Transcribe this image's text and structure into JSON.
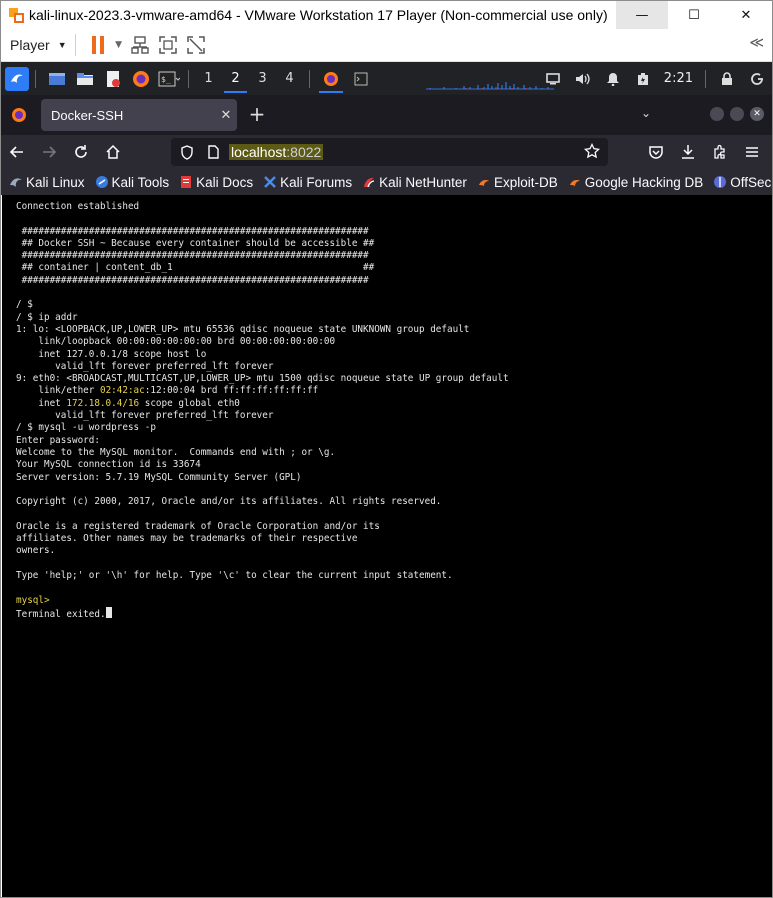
{
  "window": {
    "title": "kali-linux-2023.3-vmware-amd64 - VMware Workstation 17 Player (Non-commercial use only)",
    "controls": {
      "minimize": "—",
      "maximize": "☐",
      "close": "✕"
    }
  },
  "vmware_toolbar": {
    "player_label": "Player"
  },
  "kali_panel": {
    "workspaces": [
      "1",
      "2",
      "3",
      "4"
    ],
    "active_workspace": "2",
    "clock": "2:21"
  },
  "browser": {
    "tab": {
      "label": "Docker-SSH"
    },
    "url": {
      "host": "localhost",
      "port": ":8022"
    },
    "bookmarks": [
      {
        "label": "Kali Linux",
        "icon": "kali-dragon-icon"
      },
      {
        "label": "Kali Tools",
        "icon": "kali-tools-icon"
      },
      {
        "label": "Kali Docs",
        "icon": "kali-docs-icon"
      },
      {
        "label": "Kali Forums",
        "icon": "kali-forums-icon"
      },
      {
        "label": "Kali NetHunter",
        "icon": "nethunter-icon"
      },
      {
        "label": "Exploit-DB",
        "icon": "exploit-db-icon"
      },
      {
        "label": "Google Hacking DB",
        "icon": "ghdb-icon"
      },
      {
        "label": "OffSec",
        "icon": "offsec-icon"
      }
    ]
  },
  "terminal": {
    "lines": [
      {
        "text": "Connection established"
      },
      {
        "text": ""
      },
      {
        "text": " ##############################################################"
      },
      {
        "text": " ## Docker SSH ~ Because every container should be accessible ##"
      },
      {
        "text": " ##############################################################"
      },
      {
        "text": " ## container | content_db_1                                  ##"
      },
      {
        "text": " ##############################################################"
      },
      {
        "text": ""
      },
      {
        "text": "/ $"
      },
      {
        "text": "/ $ ip addr"
      },
      {
        "text": "1: lo: <LOOPBACK,UP,LOWER_UP> mtu 65536 qdisc noqueue state UNKNOWN group default"
      },
      {
        "text": "    link/loopback 00:00:00:00:00:00 brd 00:00:00:00:00:00"
      },
      {
        "text": "    inet 127.0.0.1/8 scope host lo"
      },
      {
        "text": "       valid_lft forever preferred_lft forever"
      },
      {
        "text": "9: eth0: <BROADCAST,MULTICAST,UP,LOWER_UP> mtu 1500 qdisc noqueue state UP group default"
      },
      {
        "pre": "    link/ether ",
        "hl": "02:42:ac",
        "post": ":12:00:04 brd ff:ff:ff:ff:ff:ff"
      },
      {
        "pre": "    inet ",
        "hl": "172.18.0.4/16",
        "post": " scope global eth0"
      },
      {
        "text": "       valid_lft forever preferred_lft forever"
      },
      {
        "text": "/ $ mysql -u wordpress -p"
      },
      {
        "text": "Enter password:"
      },
      {
        "text": "Welcome to the MySQL monitor.  Commands end with ; or \\g."
      },
      {
        "text": "Your MySQL connection id is 33674"
      },
      {
        "text": "Server version: 5.7.19 MySQL Community Server (GPL)"
      },
      {
        "text": ""
      },
      {
        "text": "Copyright (c) 2000, 2017, Oracle and/or its affiliates. All rights reserved."
      },
      {
        "text": ""
      },
      {
        "text": "Oracle is a registered trademark of Oracle Corporation and/or its"
      },
      {
        "text": "affiliates. Other names may be trademarks of their respective"
      },
      {
        "text": "owners."
      },
      {
        "text": ""
      },
      {
        "text": "Type 'help;' or '\\h' for help. Type '\\c' to clear the current input statement."
      },
      {
        "text": ""
      },
      {
        "hl": "mysql>"
      },
      {
        "text": "Terminal exited.",
        "cursor": true
      }
    ],
    "colors": {
      "background": "#000000",
      "foreground": "#e6e6e6",
      "highlight": "#e8d34a"
    }
  }
}
